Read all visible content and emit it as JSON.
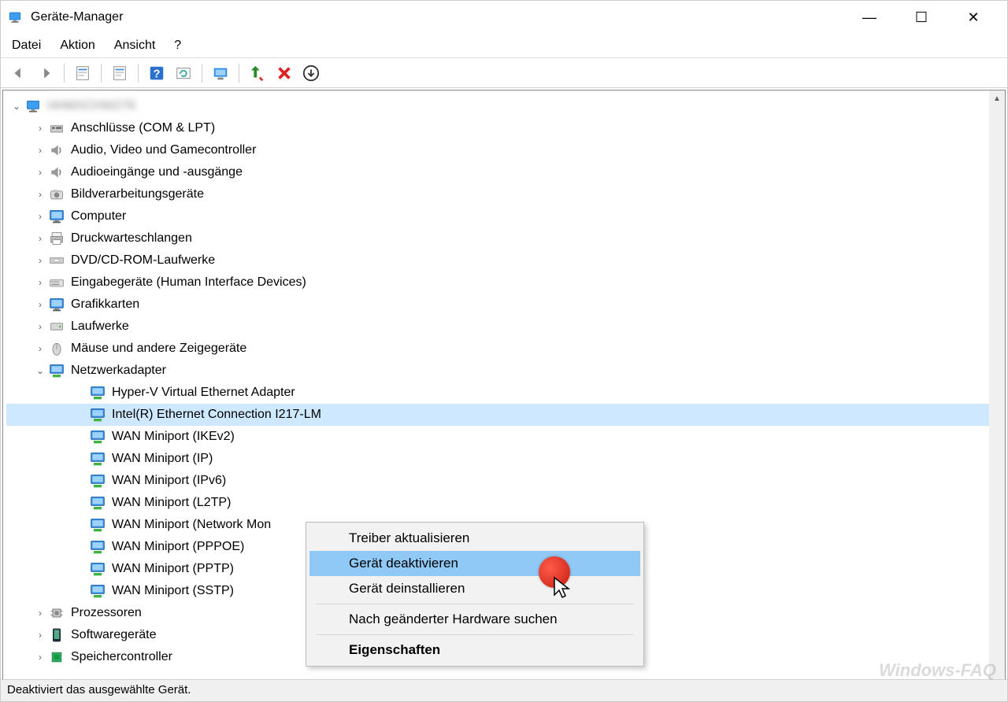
{
  "window": {
    "title": "Geräte-Manager"
  },
  "menu": {
    "file": "Datei",
    "action": "Aktion",
    "view": "Ansicht",
    "help": "?"
  },
  "tree": {
    "root": "HHMXCHW276",
    "cat": {
      "ports": "Anschlüsse (COM & LPT)",
      "audio_video": "Audio, Video und Gamecontroller",
      "audio_io": "Audioeingänge und -ausgänge",
      "imaging": "Bildverarbeitungsgeräte",
      "computer": "Computer",
      "print_queues": "Druckwarteschlangen",
      "dvdcd": "DVD/CD-ROM-Laufwerke",
      "hid": "Eingabegeräte (Human Interface Devices)",
      "graphics": "Grafikkarten",
      "drives": "Laufwerke",
      "mice": "Mäuse und andere Zeigegeräte",
      "net": "Netzwerkadapter",
      "cpu": "Prozessoren",
      "software": "Softwaregeräte",
      "storage": "Speichercontroller"
    },
    "net_items": [
      "Hyper-V Virtual Ethernet Adapter",
      "Intel(R) Ethernet Connection I217-LM",
      "WAN Miniport (IKEv2)",
      "WAN Miniport (IP)",
      "WAN Miniport (IPv6)",
      "WAN Miniport (L2TP)",
      "WAN Miniport (Network Mon",
      "WAN Miniport (PPPOE)",
      "WAN Miniport (PPTP)",
      "WAN Miniport (SSTP)"
    ]
  },
  "context": {
    "update": "Treiber aktualisieren",
    "disable": "Gerät deaktivieren",
    "uninstall": "Gerät deinstallieren",
    "scan": "Nach geänderter Hardware suchen",
    "properties": "Eigenschaften"
  },
  "status": "Deaktiviert das ausgewählte Gerät.",
  "watermark": "Windows-FAQ"
}
